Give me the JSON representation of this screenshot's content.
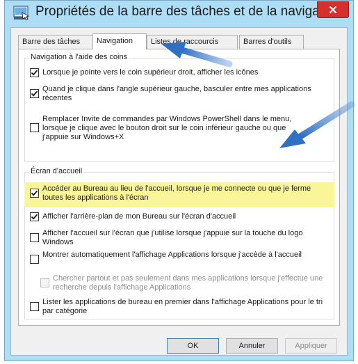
{
  "window": {
    "title": "Propriétés de la barre des tâches et de la navigati...",
    "close_label": "×"
  },
  "tabs": [
    {
      "label": "Barre des tâches",
      "active": false
    },
    {
      "label": "Navigation",
      "active": true
    },
    {
      "label": "Listes de raccourcis",
      "active": false
    },
    {
      "label": "Barres d'outils",
      "active": false
    }
  ],
  "groups": {
    "corners": {
      "label": "Navigation à l'aide des coins",
      "options": [
        {
          "text": "Lorsque je pointe vers le coin supérieur droit, afficher les icônes",
          "checked": true
        },
        {
          "text": "Quand je clique dans l'angle supérieur gauche, basculer entre mes applications récentes",
          "checked": true
        },
        {
          "text": "Remplacer Invite de commandes par Windows PowerShell dans le menu, lorsque je clique avec le bouton droit sur le coin inférieur gauche ou que j'appuie sur Windows+X",
          "checked": false
        }
      ]
    },
    "start": {
      "label": "Écran d'accueil",
      "options": [
        {
          "text": "Accéder au Bureau au lieu de l'accueil, lorsque je me connecte ou que je ferme toutes les applications à l'écran",
          "checked": true,
          "highlighted": true
        },
        {
          "text": "Afficher l'arrière-plan de mon Bureau sur l'écran d'accueil",
          "checked": true
        },
        {
          "text": "Afficher l'accueil sur l'écran que j'utilise lorsque j'appuie sur la touche du logo Windows",
          "checked": false
        },
        {
          "text": "Montrer automatiquement l'affichage Applications lorsque j'accède à l'accueil",
          "checked": false
        },
        {
          "text": "Chercher partout et pas seulement dans mes applications lorsque j'effectue une recherche depuis l'affichage Applications",
          "checked": false,
          "disabled": true
        },
        {
          "text": "Lister les applications de bureau en premier dans l'affichage Applications pour le tri par catégorie",
          "checked": false
        }
      ]
    }
  },
  "buttons": {
    "ok": "OK",
    "cancel": "Annuler",
    "apply": "Appliquer"
  },
  "colors": {
    "highlight": "#fbf59a",
    "arrow": "#3b78c9",
    "close": "#d5302b"
  }
}
